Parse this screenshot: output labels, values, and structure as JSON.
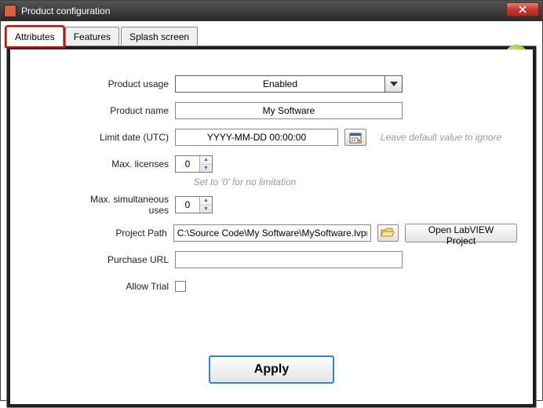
{
  "window": {
    "title": "Product configuration"
  },
  "tabs": {
    "attributes": "Attributes",
    "features": "Features",
    "splash": "Splash screen"
  },
  "form": {
    "product_usage": {
      "label": "Product usage",
      "value": "Enabled"
    },
    "product_name": {
      "label": "Product name",
      "value": "My Software"
    },
    "limit_date": {
      "label": "Limit date (UTC)",
      "value": "YYYY-MM-DD 00:00:00",
      "hint": "Leave default value to ignore"
    },
    "max_licenses": {
      "label": "Max. licenses",
      "value": "0",
      "hint": "Set to '0' for no limitation"
    },
    "max_simul": {
      "label": "Max. simultaneous uses",
      "value": "0"
    },
    "project_path": {
      "label": "Project Path",
      "value": "C:\\Source Code\\My Software\\MySoftware.lvproj",
      "open_button": "Open LabVIEW Project"
    },
    "purchase_url": {
      "label": "Purchase URL",
      "value": ""
    },
    "allow_trial": {
      "label": "Allow Trial"
    }
  },
  "apply": "Apply"
}
